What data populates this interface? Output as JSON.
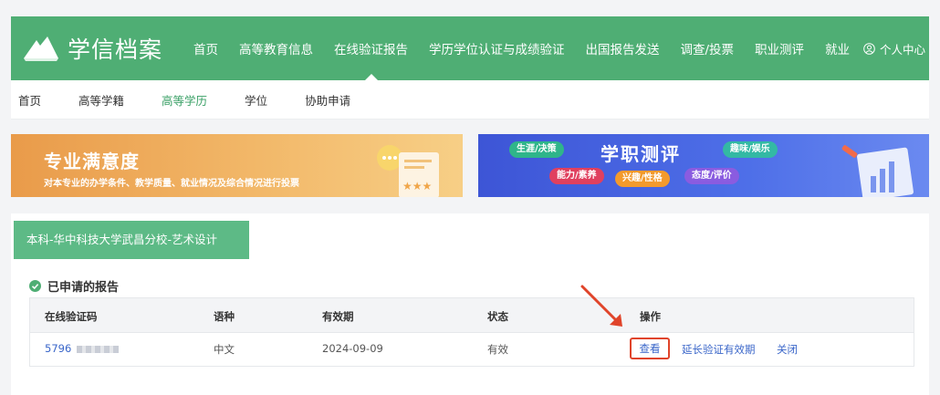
{
  "app": {
    "logo_text": "学信档案"
  },
  "nav": {
    "items": [
      {
        "label": "首页"
      },
      {
        "label": "高等教育信息"
      },
      {
        "label": "在线验证报告"
      },
      {
        "label": "学历学位认证与成绩验证"
      },
      {
        "label": "出国报告发送"
      },
      {
        "label": "调查/投票"
      },
      {
        "label": "职业测评"
      },
      {
        "label": "就业"
      }
    ],
    "active_index": 2,
    "user_label": "个人中心"
  },
  "subnav": {
    "items": [
      {
        "label": "首页"
      },
      {
        "label": "高等学籍"
      },
      {
        "label": "高等学历"
      },
      {
        "label": "学位"
      },
      {
        "label": "协助申请"
      }
    ],
    "active_index": 2
  },
  "banner_left": {
    "title": "专业满意度",
    "subtitle": "对本专业的办学条件、教学质量、就业情况及综合情况进行投票"
  },
  "banner_right": {
    "title": "学职测评",
    "pills": [
      "生涯/决策",
      "趣味/娱乐",
      "能力/素养",
      "兴趣/性格",
      "态度/评价"
    ]
  },
  "record": {
    "school_tab": "本科-华中科技大学武昌分校-艺术设计",
    "section_title": "已申请的报告",
    "columns": [
      "在线验证码",
      "语种",
      "有效期",
      "状态",
      "操作"
    ],
    "rows": [
      {
        "code": "5796",
        "language": "中文",
        "expiry": "2024-09-09",
        "status": "有效",
        "actions": {
          "view": "查看",
          "extend": "延长验证有效期",
          "close": "关闭"
        }
      }
    ]
  },
  "colors": {
    "brand_green": "#4fae74",
    "link_blue": "#3a66c9",
    "highlight_red": "#e0442a"
  }
}
